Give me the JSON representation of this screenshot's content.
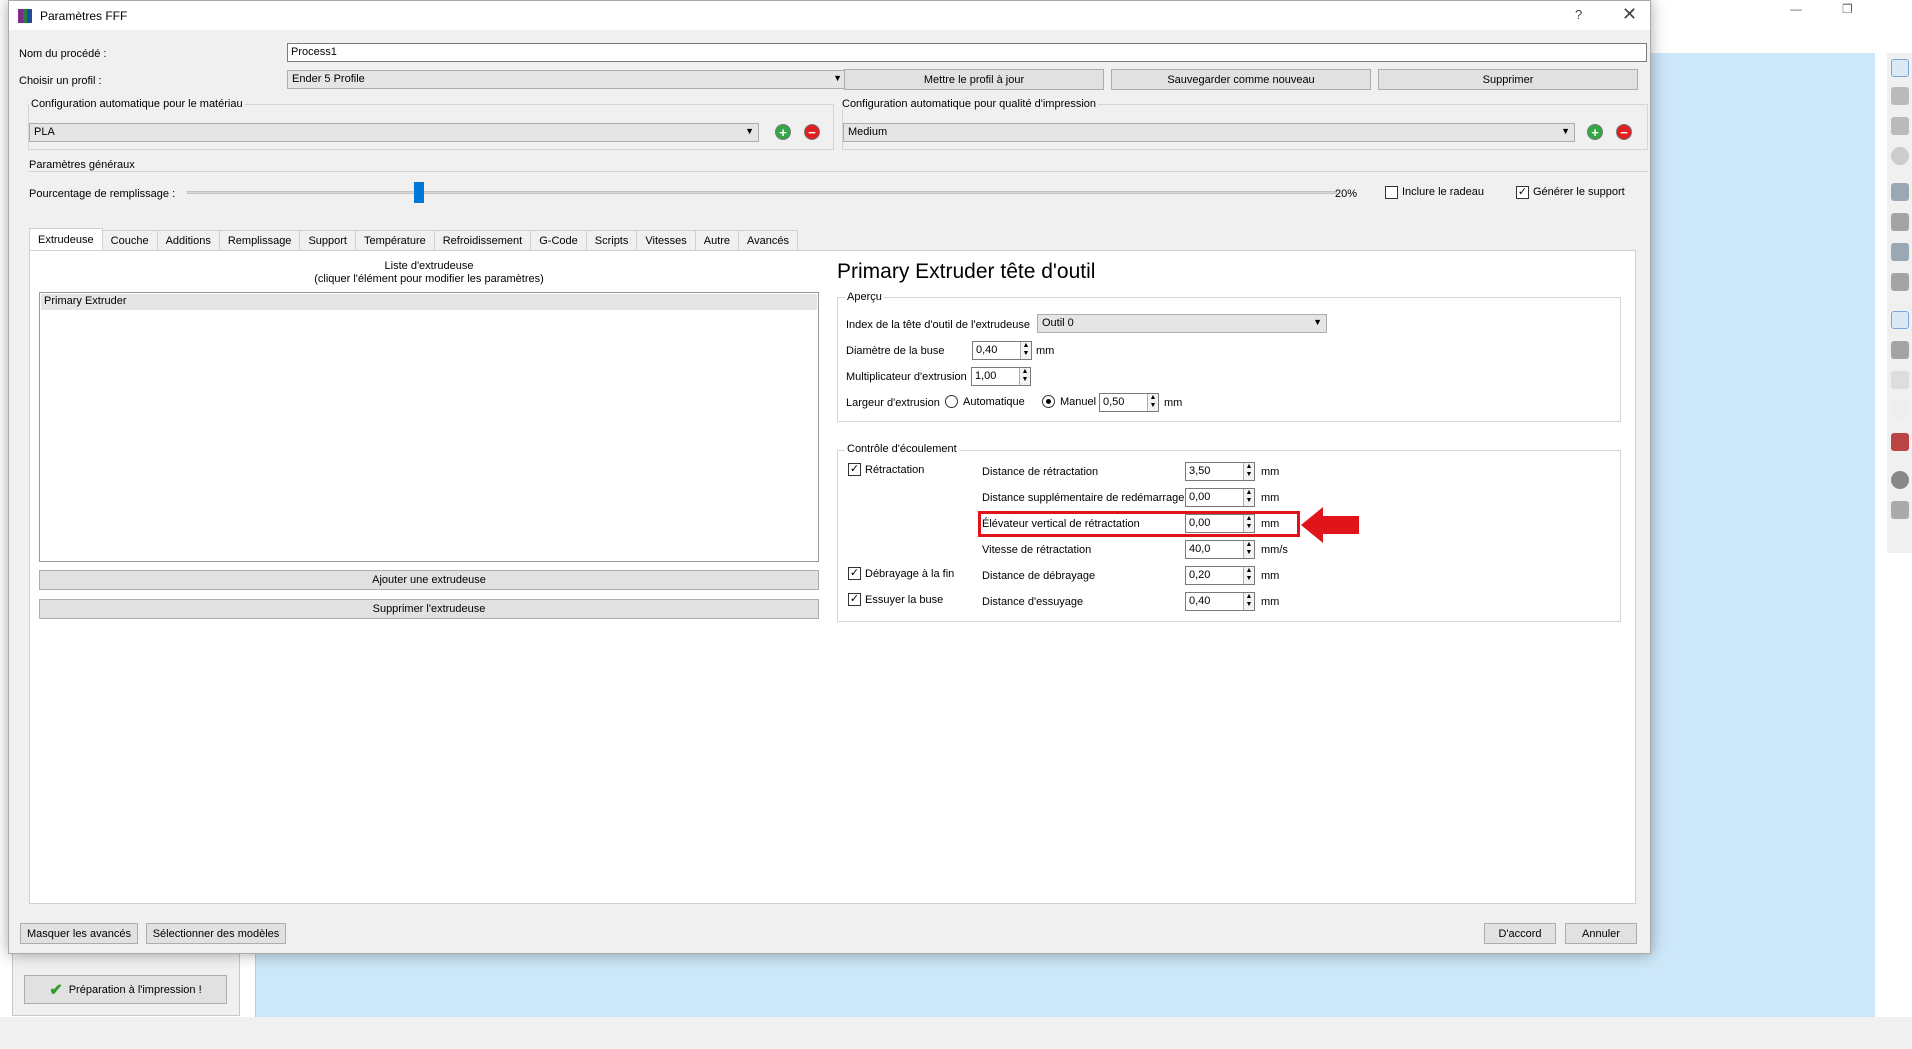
{
  "dialog": {
    "title": "Paramètres FFF",
    "help": "?",
    "close": "✕"
  },
  "process": {
    "name_label": "Nom du procédé :",
    "name_value": "Process1",
    "profile_label": "Choisir un profil :",
    "profile_value": "Ender 5 Profile",
    "update_btn": "Mettre le profil à jour",
    "save_new_btn": "Sauvegarder comme nouveau",
    "delete_btn": "Supprimer"
  },
  "material": {
    "title": "Configuration automatique pour le matériau",
    "value": "PLA"
  },
  "quality": {
    "title": "Configuration automatique pour qualité d'impression",
    "value": "Medium"
  },
  "general": {
    "title": "Paramètres généraux",
    "infill_label": "Pourcentage de remplissage :",
    "infill_value": "20%",
    "infill_fraction": 0.2,
    "raft_label": "Inclure le radeau",
    "raft_checked": false,
    "support_label": "Générer le support",
    "support_checked": true
  },
  "tabs": [
    {
      "label": "Extrudeuse",
      "active": true
    },
    {
      "label": "Couche"
    },
    {
      "label": "Additions"
    },
    {
      "label": "Remplissage"
    },
    {
      "label": "Support"
    },
    {
      "label": "Température"
    },
    {
      "label": "Refroidissement"
    },
    {
      "label": "G-Code"
    },
    {
      "label": "Scripts"
    },
    {
      "label": "Vitesses"
    },
    {
      "label": "Autre"
    },
    {
      "label": "Avancés"
    }
  ],
  "extruder_list": {
    "title_line1": "Liste d'extrudeuse",
    "title_line2": "(cliquer l'élément pour modifier les paramètres)",
    "items": [
      "Primary Extruder"
    ],
    "add_btn": "Ajouter une extrudeuse",
    "remove_btn": "Supprimer l'extrudeuse"
  },
  "extruder_detail": {
    "heading": "Primary Extruder tête d'outil",
    "overview_title": "Aperçu",
    "tool_index_label": "Index de la tête d'outil de l'extrudeuse",
    "tool_index_value": "Outil 0",
    "nozzle_label": "Diamètre de la buse",
    "nozzle_value": "0,40",
    "nozzle_unit": "mm",
    "multiplier_label": "Multiplicateur d'extrusion",
    "multiplier_value": "1,00",
    "width_label": "Largeur d'extrusion",
    "width_auto": "Automatique",
    "width_manual": "Manuel",
    "width_value": "0,50",
    "width_unit": "mm"
  },
  "flow": {
    "title": "Contrôle d'écoulement",
    "retraction_check": "Rétractation",
    "coast_check": "Débrayage à la fin",
    "wipe_check": "Essuyer la buse",
    "retraction_distance_label": "Distance de rétractation",
    "retraction_distance_value": "3,50",
    "retraction_distance_unit": "mm",
    "extra_restart_label": "Distance supplémentaire de redémarrage",
    "extra_restart_value": "0,00",
    "extra_restart_unit": "mm",
    "vertical_lift_label": "Élévateur vertical de rétractation",
    "vertical_lift_value": "0,00",
    "vertical_lift_unit": "mm",
    "retraction_speed_label": "Vitesse de rétractation",
    "retraction_speed_value": "40,0",
    "retraction_speed_unit": "mm/s",
    "coast_distance_label": "Distance de débrayage",
    "coast_distance_value": "0,20",
    "coast_distance_unit": "mm",
    "wipe_distance_label": "Distance d'essuyage",
    "wipe_distance_value": "0,40",
    "wipe_distance_unit": "mm"
  },
  "footer": {
    "hide_advanced": "Masquer les avancés",
    "select_models": "Sélectionner des modèles",
    "ok": "D'accord",
    "cancel": "Annuler"
  },
  "background": {
    "prepare_btn": "Préparation à l'impression !",
    "win_minimize": "—",
    "win_restore": "❐"
  },
  "colors": {
    "highlight": "#e1141b",
    "slider_handle": "#0078d7",
    "viewport": "#cce7f8"
  }
}
